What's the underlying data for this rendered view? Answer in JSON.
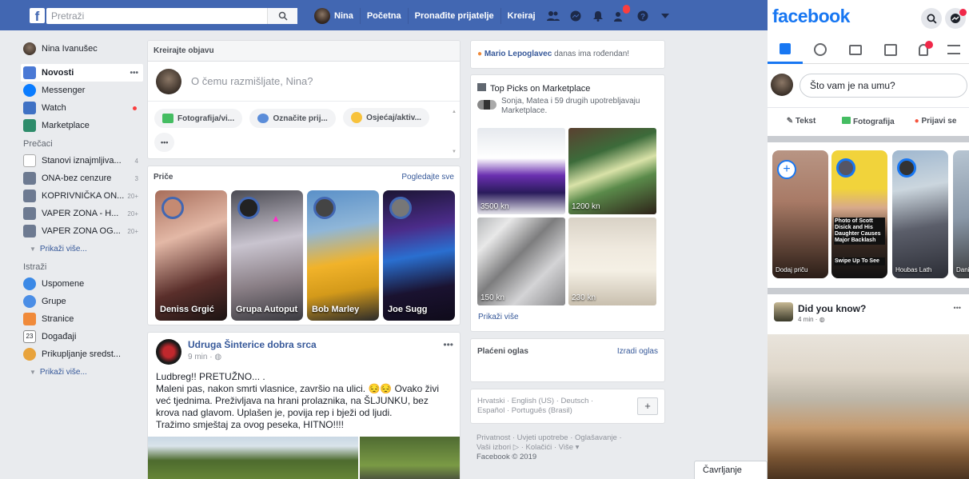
{
  "topbar": {
    "search_placeholder": "Pretraži",
    "user": "Nina",
    "nav": [
      "Početna",
      "Pronađite prijatelje",
      "Kreiraj"
    ]
  },
  "left": {
    "profile_name": "Nina Ivanušec",
    "main": [
      {
        "label": "Novosti",
        "extra": "•••"
      },
      {
        "label": "Messenger"
      },
      {
        "label": "Watch"
      },
      {
        "label": "Marketplace"
      }
    ],
    "shortcuts_title": "Prečaci",
    "shortcuts": [
      {
        "label": "Stanovi iznajmljiva...",
        "count": "4"
      },
      {
        "label": "ONA-bez cenzure",
        "count": "3"
      },
      {
        "label": "KOPRIVNIČKA ON...",
        "count": "20+"
      },
      {
        "label": "VAPER ZONA - H...",
        "count": "20+"
      },
      {
        "label": "VAPER ZONA OG...",
        "count": "20+"
      }
    ],
    "show_more": "Prikaži više...",
    "explore_title": "Istraži",
    "explore": [
      "Uspomene",
      "Grupe",
      "Stranice",
      "Događaji",
      "Prikupljanje sredst..."
    ],
    "explore_more": "Prikaži više..."
  },
  "composer": {
    "title": "Kreirajte objavu",
    "prompt": "O čemu razmišljate, Nina?",
    "actions": [
      "Fotografija/vi...",
      "Označite prij...",
      "Osjećaj/aktiv..."
    ],
    "more": "•••"
  },
  "stories": {
    "title": "Priče",
    "see_all": "Pogledajte sve",
    "items": [
      "Deniss Grgić",
      "Grupa Autoput",
      "Bob Marley",
      "Joe Sugg"
    ]
  },
  "post": {
    "author": "Udruga Šinterice dobra srca",
    "time": "9 min ·",
    "more": "•••",
    "line1": "Ludbreg!! PRETUŽNO... .",
    "body": "Maleni pas, nakon smrti vlasnice, završio na ulici. 😔😔 Ovako živi već tjednima. Preživljava na hrani prolaznika, na ŠLJUNKU, bez krova nad glavom. Uplašen je, povija rep i bježi od ljudi.",
    "line_last": "Tražimo smještaj za ovog peseka, HITNO!!!!"
  },
  "birthday": {
    "name": "Mario Lepoglavec",
    "text": "danas ima rođendan!"
  },
  "marketplace": {
    "title": "Top Picks on Marketplace",
    "subtitle": "Sonja, Matea i 59 drugih upotrebljavaju Marketplace.",
    "prices": [
      "3500 kn",
      "1200 kn",
      "150 kn",
      "230 kn"
    ],
    "more": "Prikaži više"
  },
  "ads": {
    "title": "Plaćeni oglas",
    "create": "Izradi oglas"
  },
  "langs": {
    "line1": "Hrvatski · English (US) · Deutsch ·",
    "line2": "Español · Português (Brasil)",
    "plus": "+"
  },
  "footer": {
    "line1": "Privatnost · Uvjeti upotrebe · Oglašavanje ·",
    "line2": "Vaši izbori ▷ · Kolačići · Više ▾",
    "line3": "Facebook © 2019"
  },
  "chat": "Čavrljanje",
  "mobile": {
    "brand": "facebook",
    "prompt": "Što vam je na umu?",
    "actions": [
      "Tekst",
      "Fotografija",
      "Prijavi se"
    ],
    "stories": [
      "Dodaj priču",
      "",
      "Houbas Lath",
      "Dani"
    ],
    "story_caption": "Photo of Scott Disick and His Daughter Causes Major Backlash",
    "story_caption2": "Swipe Up To See",
    "post_title": "Did you know?",
    "post_time": "4 min ·",
    "post_more": "•••"
  },
  "colors": {
    "brand": "#4267b2",
    "link": "#365899",
    "bg": "#e9ebee"
  }
}
